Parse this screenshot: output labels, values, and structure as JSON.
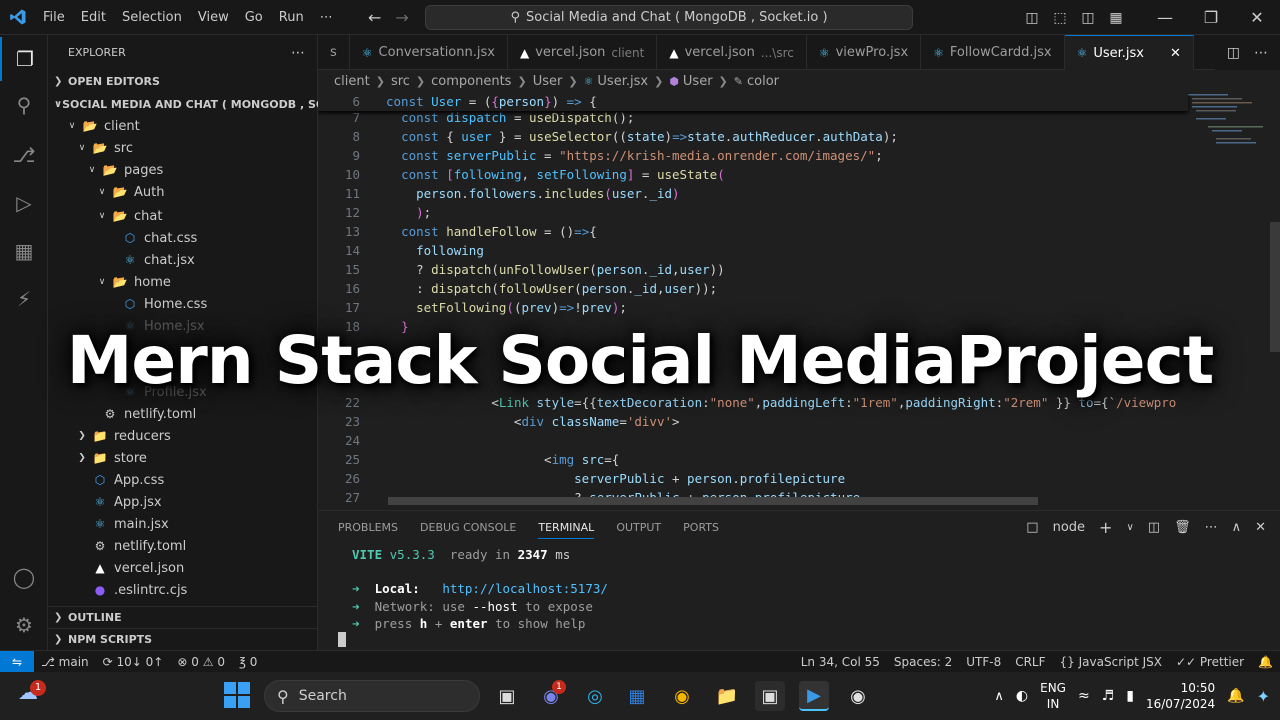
{
  "titlebar": {
    "menu": [
      "File",
      "Edit",
      "Selection",
      "View",
      "Go",
      "Run",
      "⋯"
    ],
    "command_center": "Social Media and Chat ( MongoDB , Socket.io )"
  },
  "sidebar": {
    "title": "EXPLORER",
    "open_editors": "OPEN EDITORS",
    "workspace": "SOCIAL MEDIA AND CHAT ( MONGODB , SOC...",
    "tree": [
      {
        "label": "client",
        "depth": 1,
        "kind": "folder-open",
        "color": "#e06c75"
      },
      {
        "label": "src",
        "depth": 2,
        "kind": "folder-open",
        "color": "#4caf50"
      },
      {
        "label": "pages",
        "depth": 3,
        "kind": "folder-open",
        "color": "#e06c75"
      },
      {
        "label": "Auth",
        "depth": 4,
        "kind": "folder-open",
        "color": "#d7a34a"
      },
      {
        "label": "chat",
        "depth": 4,
        "kind": "folder-open",
        "color": "#d7a34a"
      },
      {
        "label": "chat.css",
        "depth": 5,
        "kind": "css",
        "color": "#42a5f5"
      },
      {
        "label": "chat.jsx",
        "depth": 5,
        "kind": "react",
        "color": "#4fc3f7"
      },
      {
        "label": "home",
        "depth": 4,
        "kind": "folder-open",
        "color": "#d7a34a"
      },
      {
        "label": "Home.css",
        "depth": 5,
        "kind": "css",
        "color": "#42a5f5"
      },
      {
        "label": "Home.jsx",
        "depth": 5,
        "kind": "react",
        "color": "#4fc3f7"
      },
      {
        "label": "Profile.jsx",
        "depth": 5,
        "kind": "react",
        "color": "#4fc3f7"
      },
      {
        "label": "netlify.toml",
        "depth": 3,
        "kind": "gear",
        "color": "#cccccc"
      },
      {
        "label": "reducers",
        "depth": 2,
        "kind": "folder",
        "color": "#d7a34a"
      },
      {
        "label": "store",
        "depth": 2,
        "kind": "folder",
        "color": "#d7a34a"
      },
      {
        "label": "App.css",
        "depth": 2,
        "kind": "css",
        "color": "#42a5f5"
      },
      {
        "label": "App.jsx",
        "depth": 2,
        "kind": "react",
        "color": "#4fc3f7"
      },
      {
        "label": "main.jsx",
        "depth": 2,
        "kind": "react",
        "color": "#4fc3f7"
      },
      {
        "label": "netlify.toml",
        "depth": 2,
        "kind": "gear",
        "color": "#cccccc"
      },
      {
        "label": "vercel.json",
        "depth": 2,
        "kind": "vercel",
        "color": "#ffffff"
      },
      {
        "label": ".eslintrc.cjs",
        "depth": 2,
        "kind": "eslint",
        "color": "#8b5cf6"
      }
    ],
    "outline": "OUTLINE",
    "npm_scripts": "NPM SCRIPTS"
  },
  "tabs": [
    {
      "label": "s",
      "desc": "",
      "icon": "react",
      "active": false
    },
    {
      "label": "Conversationn.jsx",
      "desc": "",
      "icon": "react",
      "active": false
    },
    {
      "label": "vercel.json",
      "desc": "client",
      "icon": "vercel",
      "active": false
    },
    {
      "label": "vercel.json",
      "desc": "...\\src",
      "icon": "vercel",
      "active": false
    },
    {
      "label": "viewPro.jsx",
      "desc": "",
      "icon": "react",
      "active": false
    },
    {
      "label": "FollowCardd.jsx",
      "desc": "",
      "icon": "react",
      "active": false
    },
    {
      "label": "User.jsx",
      "desc": "",
      "icon": "react",
      "active": true
    }
  ],
  "breadcrumb": [
    "client",
    "src",
    "components",
    "User",
    "User.jsx",
    "User",
    "color"
  ],
  "code": [
    {
      "n": "6",
      "tokens": [
        [
          "kw",
          "const "
        ],
        [
          "cst",
          "User"
        ],
        [
          "pl",
          " = ("
        ],
        [
          "brk",
          "{"
        ],
        [
          "var",
          "person"
        ],
        [
          "brk",
          "}"
        ],
        [
          "pl",
          ") "
        ],
        [
          "kw",
          "=>"
        ],
        [
          "pl",
          " {"
        ]
      ]
    },
    {
      "n": "7",
      "tokens": [
        [
          "pl",
          "  "
        ],
        [
          "kw",
          "const "
        ],
        [
          "cst",
          "dispatch"
        ],
        [
          "pl",
          " = "
        ],
        [
          "fn",
          "useDispatch"
        ],
        [
          "pl",
          "();"
        ]
      ]
    },
    {
      "n": "8",
      "tokens": [
        [
          "pl",
          "  "
        ],
        [
          "kw",
          "const "
        ],
        [
          "pl",
          "{ "
        ],
        [
          "cst",
          "user"
        ],
        [
          "pl",
          " } = "
        ],
        [
          "fn",
          "useSelector"
        ],
        [
          "pl",
          "(("
        ],
        [
          "var",
          "state"
        ],
        [
          "pl",
          ")"
        ],
        [
          "kw",
          "=>"
        ],
        [
          "var",
          "state"
        ],
        [
          "pl",
          "."
        ],
        [
          "var",
          "authReducer"
        ],
        [
          "pl",
          "."
        ],
        [
          "var",
          "authData"
        ],
        [
          "pl",
          ");"
        ]
      ]
    },
    {
      "n": "9",
      "tokens": [
        [
          "pl",
          "  "
        ],
        [
          "kw",
          "const "
        ],
        [
          "cst",
          "serverPublic"
        ],
        [
          "pl",
          " = "
        ],
        [
          "str",
          "\"https://krish-media.onrender.com/images/\""
        ],
        [
          "pl",
          ";"
        ]
      ]
    },
    {
      "n": "10",
      "tokens": [
        [
          "pl",
          "  "
        ],
        [
          "kw",
          "const "
        ],
        [
          "brk",
          "["
        ],
        [
          "cst",
          "following"
        ],
        [
          "pl",
          ", "
        ],
        [
          "cst",
          "setFollowing"
        ],
        [
          "brk",
          "]"
        ],
        [
          "pl",
          " = "
        ],
        [
          "fn",
          "useState"
        ],
        [
          "brk",
          "("
        ]
      ]
    },
    {
      "n": "11",
      "tokens": [
        [
          "pl",
          "    "
        ],
        [
          "var",
          "person"
        ],
        [
          "pl",
          "."
        ],
        [
          "var",
          "followers"
        ],
        [
          "pl",
          "."
        ],
        [
          "fn",
          "includes"
        ],
        [
          "brk",
          "("
        ],
        [
          "var",
          "user"
        ],
        [
          "pl",
          "."
        ],
        [
          "var",
          "_id"
        ],
        [
          "brk",
          ")"
        ]
      ]
    },
    {
      "n": "12",
      "tokens": [
        [
          "pl",
          "    "
        ],
        [
          "brk",
          ")"
        ],
        [
          "pl",
          ";"
        ]
      ]
    },
    {
      "n": "13",
      "tokens": [
        [
          "pl",
          "  "
        ],
        [
          "kw",
          "const "
        ],
        [
          "fn",
          "handleFollow"
        ],
        [
          "pl",
          " = ()"
        ],
        [
          "kw",
          "=>"
        ],
        [
          "pl",
          "{"
        ]
      ]
    },
    {
      "n": "14",
      "tokens": [
        [
          "pl",
          "    "
        ],
        [
          "var",
          "following"
        ]
      ]
    },
    {
      "n": "15",
      "tokens": [
        [
          "pl",
          "    ? "
        ],
        [
          "fn",
          "dispatch"
        ],
        [
          "pl",
          "("
        ],
        [
          "fn",
          "unFollowUser"
        ],
        [
          "pl",
          "("
        ],
        [
          "var",
          "person"
        ],
        [
          "pl",
          "."
        ],
        [
          "var",
          "_id"
        ],
        [
          "pl",
          ","
        ],
        [
          "var",
          "user"
        ],
        [
          "pl",
          "))"
        ]
      ]
    },
    {
      "n": "16",
      "tokens": [
        [
          "pl",
          "    : "
        ],
        [
          "fn",
          "dispatch"
        ],
        [
          "pl",
          "("
        ],
        [
          "fn",
          "followUser"
        ],
        [
          "pl",
          "("
        ],
        [
          "var",
          "person"
        ],
        [
          "pl",
          "."
        ],
        [
          "var",
          "_id"
        ],
        [
          "pl",
          ","
        ],
        [
          "var",
          "user"
        ],
        [
          "pl",
          "));"
        ]
      ]
    },
    {
      "n": "17",
      "tokens": [
        [
          "pl",
          "    "
        ],
        [
          "fn",
          "setFollowing"
        ],
        [
          "brk",
          "("
        ],
        [
          "pl",
          "("
        ],
        [
          "var",
          "prev"
        ],
        [
          "pl",
          ")"
        ],
        [
          "kw",
          "=>"
        ],
        [
          "pl",
          "!"
        ],
        [
          "var",
          "prev"
        ],
        [
          "brk",
          ")"
        ],
        [
          "pl",
          ";"
        ]
      ]
    },
    {
      "n": "18",
      "tokens": [
        [
          "pl",
          "  "
        ],
        [
          "brk",
          "}"
        ]
      ]
    },
    {
      "n": "22",
      "tokens": [
        [
          "pl",
          "              <"
        ],
        [
          "tag",
          "Link"
        ],
        [
          "pl",
          " "
        ],
        [
          "var",
          "style"
        ],
        [
          "pl",
          "={{"
        ],
        [
          "var",
          "textDecoration"
        ],
        [
          "pl",
          ":"
        ],
        [
          "str",
          "\"none\""
        ],
        [
          "pl",
          ","
        ],
        [
          "var",
          "paddingLeft"
        ],
        [
          "pl",
          ":"
        ],
        [
          "str",
          "\"1rem\""
        ],
        [
          "pl",
          ","
        ],
        [
          "var",
          "paddingRight"
        ],
        [
          "pl",
          ":"
        ],
        [
          "str",
          "\"2rem\""
        ],
        [
          "pl",
          " }} "
        ],
        [
          "var",
          "to"
        ],
        [
          "pl",
          "={`"
        ],
        [
          "str",
          "/viewpro"
        ]
      ]
    },
    {
      "n": "23",
      "tokens": [
        [
          "pl",
          "                 <"
        ],
        [
          "kw",
          "div"
        ],
        [
          "pl",
          " "
        ],
        [
          "var",
          "className"
        ],
        [
          "pl",
          "="
        ],
        [
          "str",
          "'divv'"
        ],
        [
          "pl",
          ">"
        ]
      ]
    },
    {
      "n": "24",
      "tokens": []
    },
    {
      "n": "25",
      "tokens": [
        [
          "pl",
          "                     <"
        ],
        [
          "kw",
          "img"
        ],
        [
          "pl",
          " "
        ],
        [
          "var",
          "src"
        ],
        [
          "pl",
          "={"
        ]
      ]
    },
    {
      "n": "26",
      "tokens": [
        [
          "pl",
          "                         "
        ],
        [
          "var",
          "serverPublic"
        ],
        [
          "pl",
          " + "
        ],
        [
          "var",
          "person"
        ],
        [
          "pl",
          "."
        ],
        [
          "var",
          "profilepicture"
        ]
      ]
    },
    {
      "n": "27",
      "tokens": [
        [
          "pl",
          "                         ? "
        ],
        [
          "var",
          "serverPublic"
        ],
        [
          "pl",
          " + "
        ],
        [
          "var",
          "person"
        ],
        [
          "pl",
          "."
        ],
        [
          "var",
          "profilepicture"
        ]
      ]
    }
  ],
  "overlay_title": "Mern Stack Social MediaProject",
  "panel": {
    "tabs": [
      "PROBLEMS",
      "DEBUG CONSOLE",
      "TERMINAL",
      "OUTPUT",
      "PORTS"
    ],
    "active_tab": "TERMINAL",
    "shell": "node"
  },
  "terminal": {
    "vite_name": "VITE",
    "vite_version": "v5.3.3",
    "ready_text": "ready in",
    "ready_ms": "2347",
    "ms": "ms",
    "local_label": "Local:",
    "local_url": "http://localhost:5173/",
    "network_label": "Network:",
    "network_text1": "use",
    "network_flag": "--host",
    "network_text2": "to expose",
    "help_text1": "press",
    "help_key1": "h",
    "help_plus": "+",
    "help_key2": "enter",
    "help_text2": "to show help"
  },
  "statusbar": {
    "branch": "main",
    "sync": "10↓ 0↑",
    "errors": "0",
    "warnings": "0",
    "ports": "0",
    "position": "Ln 34, Col 55",
    "spaces": "Spaces: 2",
    "encoding": "UTF-8",
    "eol": "CRLF",
    "language": "JavaScript JSX",
    "formatter": "Prettier"
  },
  "taskbar": {
    "weather_badge": "1",
    "search": "Search",
    "teams_badge": "1",
    "lang_top": "ENG",
    "lang_bottom": "IN",
    "time": "10:50",
    "date": "16/07/2024"
  },
  "colors": {
    "accent": "#0078d4",
    "background": "#1f1f1f",
    "sidebar": "#181818"
  }
}
